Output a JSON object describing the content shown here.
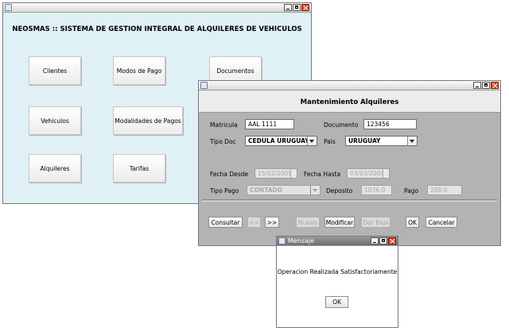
{
  "main_window": {
    "title": "NEOSMAS :: SISTEMA DE  GESTION INTEGRAL DE ALQUILERES DE VEHICULOS",
    "buttons": [
      "Clientes",
      "Modos de Pago",
      "Documentos",
      "Vehiculos",
      "Modalidades de Pagos",
      "Alquileres",
      "Tarifas"
    ]
  },
  "mant_window": {
    "title": "Mantenimiento Alquileres",
    "matricula_label": "Matricula",
    "matricula_value": "AAL 1111",
    "documento_label": "Documento",
    "documento_value": "123456",
    "tipo_doc_label": "Tipo Doc",
    "tipo_doc_value": "CEDULA URUGUAY",
    "pais_label": "Pais",
    "pais_value": "URUGUAY",
    "fecha_desde_label": "Fecha Desde",
    "fecha_desde_value": "15/02/2009",
    "fecha_hasta_label": "Fecha Hasta",
    "fecha_hasta_value": "03/03/2009",
    "tipo_pago_label": "Tipo Pago",
    "tipo_pago_value": "CONTADO",
    "deposito_label": "Deposito",
    "deposito_value": "1036.0",
    "pago_label": "Pago",
    "pago_value": "288.0",
    "buttons": {
      "consultar": "Consultar",
      "prev": "<<",
      "next": ">>",
      "nuevo": "Nuevo",
      "modificar": "Modificar",
      "dar_baja": "Dar Baja",
      "ok": "OK",
      "cancelar": "Cancelar"
    }
  },
  "msg_window": {
    "title": "Mensaje",
    "message": "Operacion Realizada Satisfactoriamente",
    "ok_label": "OK"
  }
}
